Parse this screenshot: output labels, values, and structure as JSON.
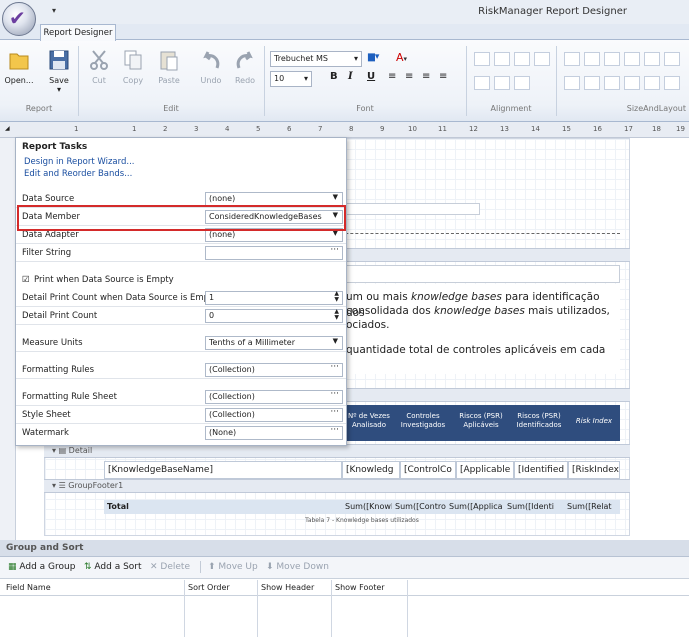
{
  "app": {
    "title": "RiskManager Report Designer",
    "tab": "Report Designer"
  },
  "ribbon": {
    "groups": {
      "report": "Report",
      "edit": "Edit",
      "font": "Font",
      "alignment": "Alignment",
      "sizelayout": "SizeAndLayout"
    },
    "buttons": {
      "open": "Open...",
      "save": "Save",
      "cut": "Cut",
      "copy": "Copy",
      "paste": "Paste",
      "undo": "Undo",
      "redo": "Redo"
    },
    "font": {
      "name": "Trebuchet MS",
      "size": "10",
      "bold": "B",
      "italic": "I",
      "underline": "U"
    }
  },
  "ruler": {
    "marks": [
      "1",
      "1",
      "2",
      "3",
      "4",
      "5",
      "6",
      "7",
      "8",
      "9",
      "10",
      "11",
      "12",
      "13",
      "14",
      "15",
      "16",
      "17",
      "18",
      "19"
    ]
  },
  "tasks": {
    "title": "Report Tasks",
    "links": [
      "Design in Report Wizard...",
      "Edit and Reorder Bands..."
    ],
    "props": [
      {
        "label": "Data Source",
        "value": "(none)",
        "ctl": "dd"
      },
      {
        "label": "Data Member",
        "value": "ConsideredKnowledgeBases",
        "ctl": "dd"
      },
      {
        "label": "Data Adapter",
        "value": "(none)",
        "ctl": "dd"
      },
      {
        "label": "Filter String",
        "value": "",
        "ctl": "el"
      },
      {
        "label": "Print when Data Source is Empty",
        "value": "",
        "ctl": "chk"
      },
      {
        "label": "Detail Print Count when Data Source is Empty",
        "value": "1",
        "ctl": "sp"
      },
      {
        "label": "Detail Print Count",
        "value": "0",
        "ctl": "sp"
      },
      {
        "label": "Measure Units",
        "value": "Tenths of a Millimeter",
        "ctl": "dd"
      },
      {
        "label": "Formatting Rules",
        "value": "(Collection)",
        "ctl": "el"
      },
      {
        "label": "Formatting Rule Sheet",
        "value": "(Collection)",
        "ctl": "el"
      },
      {
        "label": "Style Sheet",
        "value": "(Collection)",
        "ctl": "el"
      },
      {
        "label": "Watermark",
        "value": "(None)",
        "ctl": "el"
      }
    ]
  },
  "report": {
    "para1a": "um ou mais",
    "para1b": "knowledge bases",
    "para1c": "para identificação dos",
    "para2a": "consolidada dos",
    "para2b": "knowledge bases",
    "para2c": "mais utilizados,",
    "para3": "ociados.",
    "para4": "quantidade total de controles aplicáveis em cada",
    "header_cells": [
      "Nº de Vezes Analisado",
      "Controles Investigados",
      "Riscos (PSR) Aplicáveis",
      "Riscos (PSR) Identificados",
      "Risk Index"
    ],
    "detail_band": "Detail",
    "detail_cells": [
      "[KnowledgeBaseName]",
      "[Knowledg",
      "[ControlCo",
      "[Applicable",
      "[Identified",
      "[RiskIndex"
    ],
    "groupfooter": "GroupFooter1",
    "total": "Total",
    "total_cells": [
      "Sum([Knowle",
      "Sum([Contro",
      "Sum([Applica",
      "Sum([Identi",
      "Sum([Relat"
    ],
    "caption": "Tabela 7 - Knowledge bases utilizados"
  },
  "group_sort": {
    "title": "Group and Sort",
    "buttons": {
      "add_group": "Add a Group",
      "add_sort": "Add a Sort",
      "delete": "Delete",
      "move_up": "Move Up",
      "move_down": "Move Down"
    },
    "columns": [
      "Field Name",
      "Sort Order",
      "Show Header",
      "Show Footer"
    ]
  },
  "colors": {
    "accent": "#2f4d7e",
    "highlight": "#d42a2a",
    "link": "#1a4ea0"
  }
}
